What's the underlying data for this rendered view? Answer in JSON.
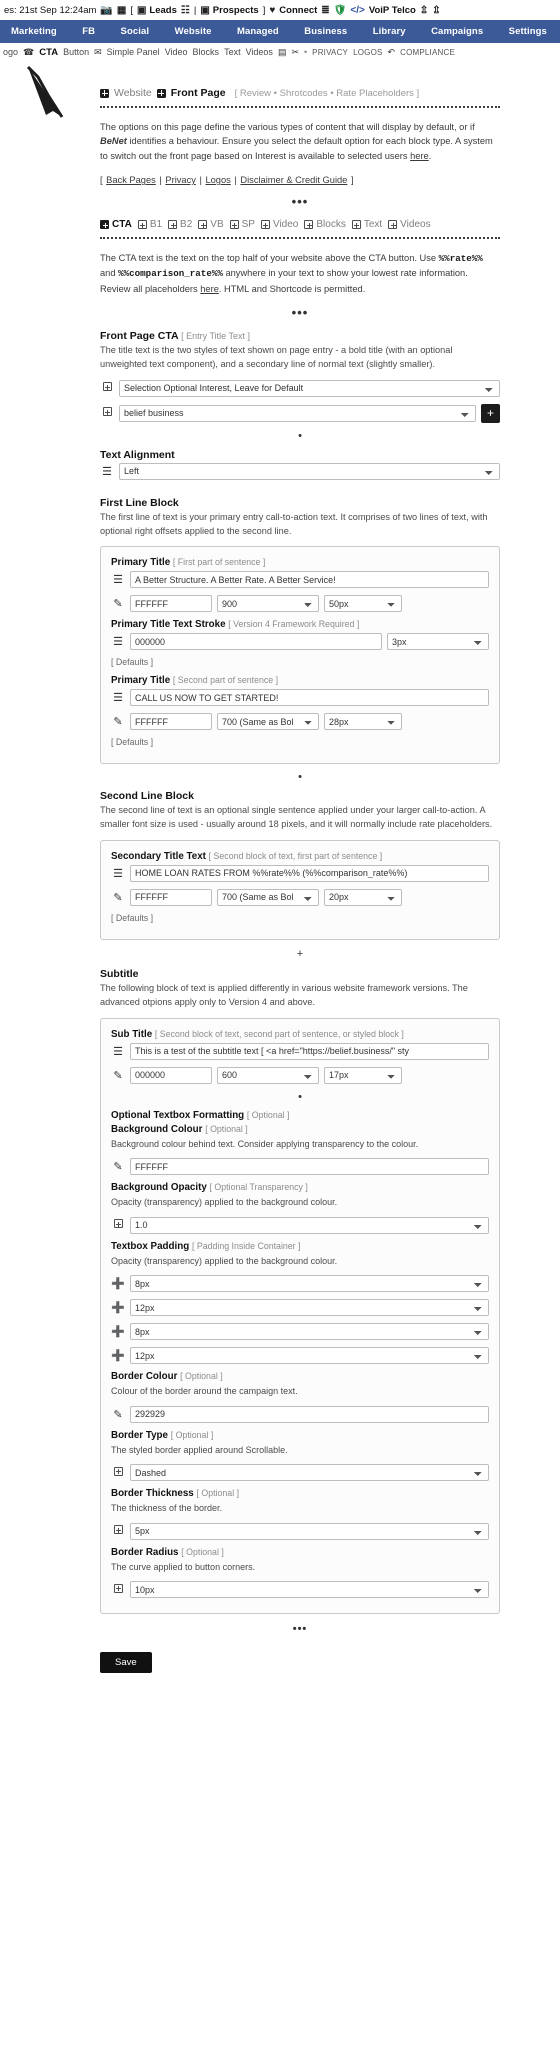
{
  "colors": {
    "nav_bg": "#3c5998",
    "ink": "#1c1c1c",
    "muted": "#8c8c8c",
    "panel_border": "#c9c9c9",
    "swatch_dark": "#000000",
    "swatch_border": "#292929"
  },
  "topstrip": {
    "date_text": "es: 21st Sep 12:24am",
    "camera_icon": "camera-icon",
    "list_icon": "list-icon",
    "bracket_open": "[",
    "leads_icon": "leads-icon",
    "leads_label": "Leads",
    "people_icon": "people-icon",
    "pipe": "|",
    "prospects_icon": "prospects-icon",
    "prospects_label": "Prospects",
    "bracket_close": "]",
    "connect_icon": "heart-icon",
    "connect_label": "Connect",
    "tasks_icon": "tasks-icon",
    "shield_icon": "shield-icon",
    "code_icon": "code-icon",
    "voip_label": "VoiP Telco",
    "import_icon": "import-icon",
    "export_icon": "export-icon"
  },
  "mainnav": {
    "items": [
      {
        "label": "Marketing"
      },
      {
        "label": "FB"
      },
      {
        "label": "Social"
      },
      {
        "label": "Website"
      },
      {
        "label": "Managed"
      },
      {
        "label": "Business"
      },
      {
        "label": "Library"
      },
      {
        "label": "Campaigns"
      },
      {
        "label": "Settings"
      }
    ]
  },
  "subnav": {
    "logo_label": "ogo",
    "phone_icon": "phone-icon",
    "cta_label": "CTA",
    "button_label": "Button",
    "mail_icon": "mail-icon",
    "simple_panel_label": "Simple Panel",
    "video_label": "Video",
    "blocks_label": "Blocks",
    "text_label": "Text",
    "videos_label": "Videos",
    "screen_icon": "screen-icon",
    "scissors_icon": "scissors-icon",
    "dot": "•",
    "privacy_label": "PRIVACY",
    "logos_label": "LOGOS",
    "undo_icon": "undo-icon",
    "compliance_label": "COMPLIANCE"
  },
  "breadcrumb": {
    "website_label": "Website",
    "frontpage_label": "Front Page",
    "meta": "[ Review  •  Shrotcodes  •  Rate Placeholders ]"
  },
  "intro": {
    "part1": "The options on this page define the various types of content that will display by default, or if ",
    "brand": "BeNet",
    "part2": " identifies a behaviour. Ensure you select the default option for each block type. A system to switch out the front page based on Interest is available to selected users ",
    "here_link": "here",
    "period": "."
  },
  "linkbar": {
    "open": "[ ",
    "links": [
      {
        "label": "Back Pages"
      },
      {
        "label": "Privacy"
      },
      {
        "label": "Logos"
      },
      {
        "label": "Disclaimer & Credit Guide"
      }
    ],
    "sep": " | ",
    "close": " ]"
  },
  "ellipsis": "•••",
  "dot_single": "•",
  "plus_single": "+",
  "block_tabs": {
    "items": [
      {
        "label": "CTA",
        "active": true
      },
      {
        "label": "B1",
        "active": false
      },
      {
        "label": "B2",
        "active": false
      },
      {
        "label": "VB",
        "active": false
      },
      {
        "label": "SP",
        "active": false
      },
      {
        "label": "Video",
        "active": false
      },
      {
        "label": "Blocks",
        "active": false
      },
      {
        "label": "Text",
        "active": false
      },
      {
        "label": "Videos",
        "active": false
      }
    ]
  },
  "cta_intro": {
    "part1": "The CTA text is the text on the top half of your website above the CTA button. Use ",
    "code1": "%%rate%%",
    "and": " and ",
    "code2": "%%comparison_rate%%",
    "part2": " anywhere in your text to show your lowest rate information. Review all placeholders ",
    "here_link": "here",
    "part3": ". HTML and Shortcode is permitted."
  },
  "front_page_cta": {
    "heading": "Front Page CTA",
    "tag": "[ Entry Title Text ]",
    "description": "The title text is the two styles of text shown on page entry - a bold title (with an optional unweighted text component), and a secondary line of normal text (slightly smaller).",
    "interest_select": {
      "icon": "plus-box-icon",
      "value": "Selection Optional Interest, Leave for Default"
    },
    "entry_select": {
      "icon": "plus-box-icon",
      "value": "belief business"
    },
    "add_button_label": "+"
  },
  "text_alignment": {
    "heading": "Text Alignment",
    "icon": "align-icon",
    "value": "Left"
  },
  "first_line_block": {
    "heading": "First Line Block",
    "description": "The first line of text is your primary entry call-to-action text. It comprises of two lines of text, with optional right offsets applied to the second line.",
    "primary_title_1": {
      "heading": "Primary Title",
      "tag": "[ First part of sentence ]",
      "align_icon": "align-icon",
      "text_value": "A Better Structure. A Better Rate. A Better Service!",
      "color_icon": "eyedropper-icon",
      "color_value": "FFFFFF",
      "weight_value": "900",
      "size_value": "50px"
    },
    "stroke": {
      "heading": "Primary Title Text Stroke",
      "tag": "[ Version 4 Framework Required ]",
      "align_icon": "align-icon",
      "color_value": "000000",
      "width_value": "3px"
    },
    "defaults_label": "[ Defaults ]",
    "primary_title_2": {
      "heading": "Primary Title",
      "tag": "[ Second part of sentence ]",
      "align_icon": "align-icon",
      "text_value": "CALL US NOW TO GET STARTED!",
      "color_icon": "eyedropper-icon",
      "color_value": "FFFFFF",
      "weight_value": "700 (Same as Bol",
      "size_value": "28px"
    },
    "defaults_label_2": "[ Defaults ]"
  },
  "second_line_block": {
    "heading": "Second Line Block",
    "description": "The second line of text is an optional single sentence applied under your larger call-to-action. A smaller font size is used - usually around 18 pixels, and it will normally include rate placeholders.",
    "secondary": {
      "heading": "Secondary Title Text",
      "tag": "[ Second block of text, first part of sentence ]",
      "align_icon": "align-icon",
      "text_value": "HOME LOAN RATES FROM %%rate%% (%%comparison_rate%%)",
      "color_icon": "eyedropper-icon",
      "color_value": "FFFFFF",
      "weight_value": "700 (Same as Bol",
      "size_value": "20px"
    },
    "defaults_label": "[ Defaults ]"
  },
  "subtitle": {
    "heading": "Subtitle",
    "description": "The following block of text is applied differently in various website framework versions. The advanced otpions apply only to Version 4 and above.",
    "sub_title": {
      "heading": "Sub Title",
      "tag": "[ Second block of text, second part of sentence, or styled block ]",
      "align_icon": "align-icon",
      "text_value": "This is a test of the subtitle text [ <a href=\"https://belief.business/\" sty",
      "color_icon": "eyedropper-icon",
      "color_value": "000000",
      "weight_value": "600",
      "size_value": "17px"
    },
    "optional_formatting": {
      "heading": "Optional Textbox Formatting",
      "tag": "[ Optional ]",
      "background_colour": {
        "heading": "Background Colour",
        "tag": "[ Optional ]",
        "description": "Background colour behind text. Consider applying transparency to the colour.",
        "icon": "eyedropper-icon",
        "value": "FFFFFF"
      },
      "background_opacity": {
        "heading": "Background Opacity",
        "tag": "[ Optional Transparency ]",
        "description": "Opacity (transparency) applied to the background colour.",
        "icon": "plus-box-icon",
        "value": "1.0"
      },
      "textbox_padding": {
        "heading": "Textbox Padding",
        "tag": "[ Padding Inside Container ]",
        "description": "Opacity (transparency) applied to the background colour.",
        "values": [
          {
            "icon": "circle-plus-icon",
            "value": "8px"
          },
          {
            "icon": "circle-plus-icon",
            "value": "12px"
          },
          {
            "icon": "circle-plus-icon",
            "value": "8px"
          },
          {
            "icon": "circle-plus-icon",
            "value": "12px"
          }
        ]
      },
      "border_colour": {
        "heading": "Border Colour",
        "tag": "[ Optional ]",
        "description": "Colour of the border around the campaign text.",
        "icon": "eyedropper-icon",
        "value": "292929"
      },
      "border_type": {
        "heading": "Border Type",
        "tag": "[ Optional ]",
        "description": "The styled border applied around Scrollable.",
        "icon": "plus-box-icon",
        "value": "Dashed"
      },
      "border_thickness": {
        "heading": "Border Thickness",
        "tag": "[ Optional ]",
        "description": "The thickness of the border.",
        "icon": "plus-box-icon",
        "value": "5px"
      },
      "border_radius": {
        "heading": "Border Radius",
        "tag": "[ Optional ]",
        "description": "The curve applied to button corners.",
        "icon": "plus-box-icon",
        "value": "10px"
      }
    }
  },
  "footer": {
    "save_label": "Save"
  }
}
